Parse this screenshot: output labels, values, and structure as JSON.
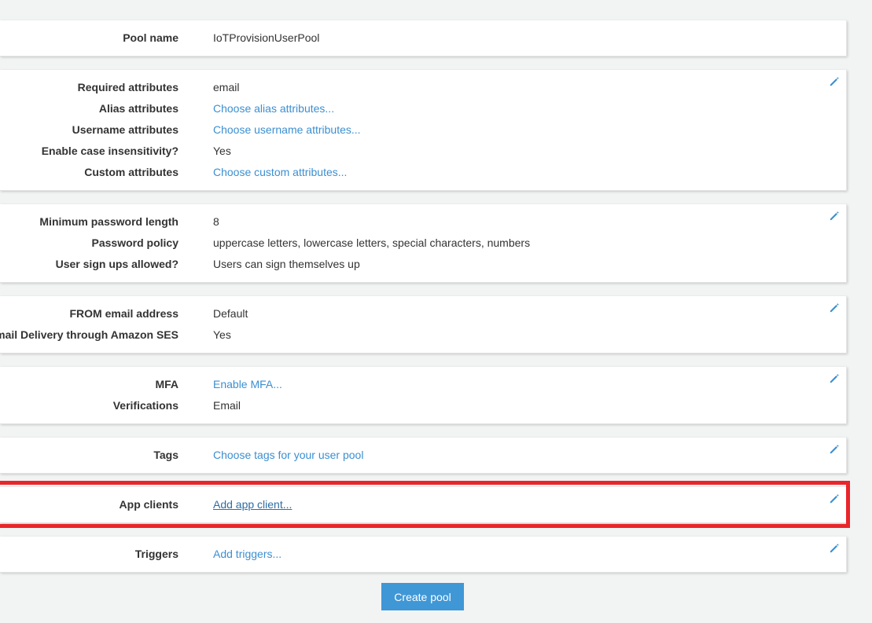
{
  "sections": {
    "pool": {
      "name_label": "Pool name",
      "name_value": "IoTProvisionUserPool"
    },
    "attributes": {
      "required_label": "Required attributes",
      "required_value": "email",
      "alias_label": "Alias attributes",
      "alias_value": "Choose alias attributes...",
      "username_label": "Username attributes",
      "username_value": "Choose username attributes...",
      "case_label": "Enable case insensitivity?",
      "case_value": "Yes",
      "custom_label": "Custom attributes",
      "custom_value": "Choose custom attributes..."
    },
    "policies": {
      "min_length_label": "Minimum password length",
      "min_length_value": "8",
      "policy_label": "Password policy",
      "policy_value": "uppercase letters, lowercase letters, special characters, numbers",
      "signup_label": "User sign ups allowed?",
      "signup_value": "Users can sign themselves up"
    },
    "email": {
      "from_label": "FROM email address",
      "from_value": "Default",
      "ses_label": "Email Delivery through Amazon SES",
      "ses_value": "Yes"
    },
    "mfa": {
      "mfa_label": "MFA",
      "mfa_value": "Enable MFA...",
      "verif_label": "Verifications",
      "verif_value": "Email"
    },
    "tags": {
      "tags_label": "Tags",
      "tags_value": "Choose tags for your user pool"
    },
    "app_clients": {
      "label": "App clients",
      "value": "Add app client..."
    },
    "triggers": {
      "label": "Triggers",
      "value": "Add triggers..."
    }
  },
  "actions": {
    "create_label": "Create pool"
  },
  "icons": {
    "edit": "pencil-icon"
  },
  "colors": {
    "link": "#3b8fd1",
    "highlight": "#e9262b",
    "button": "#3f97d6",
    "background": "#f2f3f3"
  }
}
